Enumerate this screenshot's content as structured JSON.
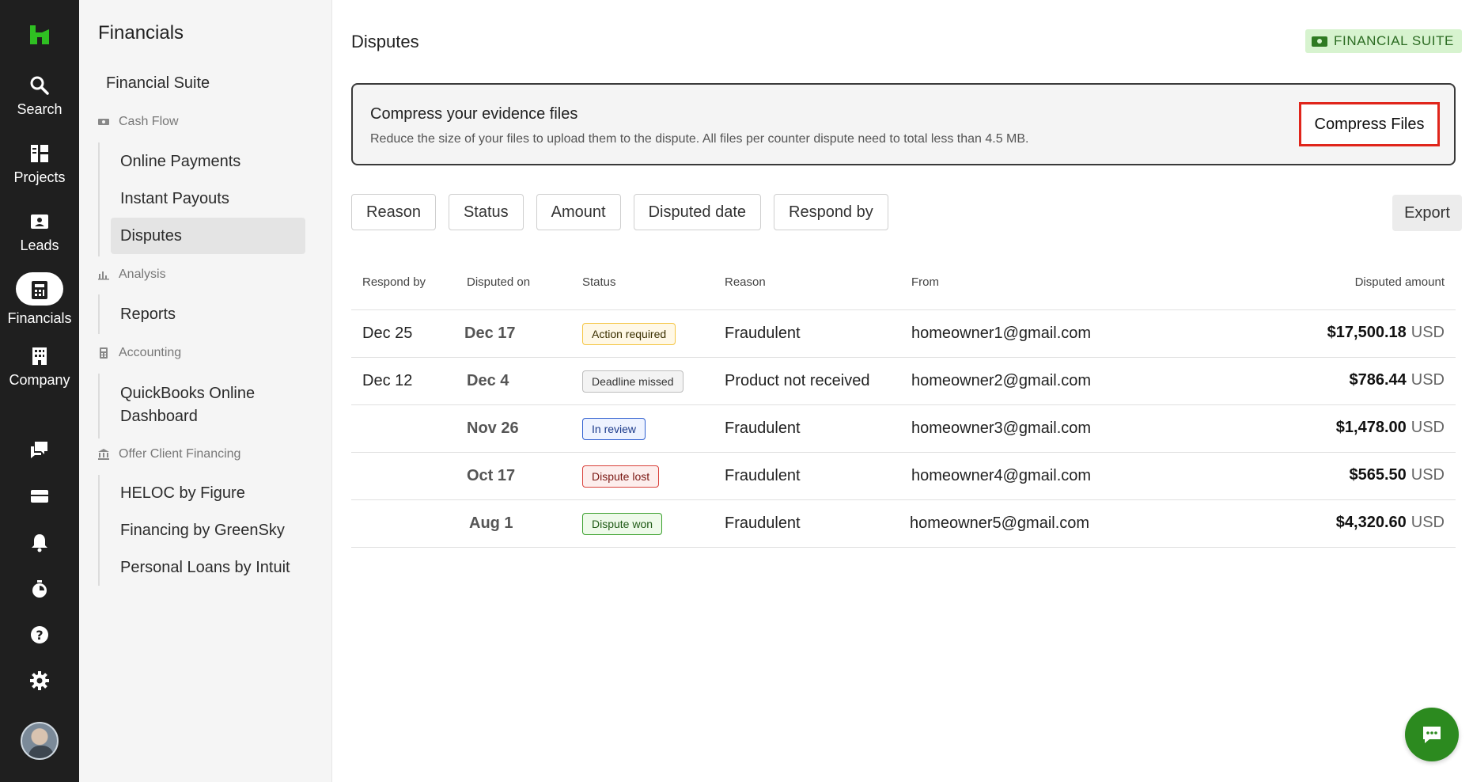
{
  "rail": {
    "items": [
      {
        "label": "Search",
        "icon": "search-icon"
      },
      {
        "label": "Projects",
        "icon": "projects-icon"
      },
      {
        "label": "Leads",
        "icon": "leads-icon"
      },
      {
        "label": "Financials",
        "icon": "financials-icon"
      },
      {
        "label": "Company",
        "icon": "company-icon"
      }
    ],
    "bottom_icons": [
      "messages-icon",
      "inbox-icon",
      "bell-icon",
      "timer-icon",
      "help-icon",
      "gear-icon"
    ]
  },
  "sidebar": {
    "title": "Financials",
    "financial_suite": "Financial Suite",
    "sections": [
      {
        "label": "Cash Flow",
        "icon": "cash-icon",
        "items": [
          "Online Payments",
          "Instant Payouts",
          "Disputes"
        ]
      },
      {
        "label": "Analysis",
        "icon": "chart-icon",
        "items": [
          "Reports"
        ]
      },
      {
        "label": "Accounting",
        "icon": "calculator-icon",
        "items": [
          "QuickBooks Online",
          "Dashboard"
        ]
      },
      {
        "label": "Offer Client Financing",
        "icon": "bank-icon",
        "items": [
          "HELOC by Figure",
          "Financing by GreenSky",
          "Personal Loans by Intuit"
        ]
      }
    ],
    "active_item": "Disputes"
  },
  "main": {
    "title": "Disputes",
    "badge": "FINANCIAL SUITE",
    "banner": {
      "title": "Compress your evidence files",
      "text": "Reduce the size of your files to upload them to the dispute. All files per counter dispute need to total less than 4.5 MB.",
      "button": "Compress Files"
    },
    "filters": [
      "Reason",
      "Status",
      "Amount",
      "Disputed date",
      "Respond by"
    ],
    "export": "Export",
    "table": {
      "headers": [
        "Respond by",
        "Disputed on",
        "Status",
        "Reason",
        "From",
        "Disputed amount"
      ],
      "rows": [
        {
          "respond_by": "Dec 25",
          "disputed_on": "Dec 17",
          "status": "Action required",
          "reason": "Fraudulent",
          "from": "homeowner1@gmail.com",
          "amount": "$17,500.18",
          "currency": "USD"
        },
        {
          "respond_by": "Dec 12",
          "disputed_on": "Dec 4",
          "status": "Deadline missed",
          "reason": "Product not received",
          "from": "homeowner2@gmail.com",
          "amount": "$786.44",
          "currency": "USD"
        },
        {
          "respond_by": "",
          "disputed_on": "Nov 26",
          "status": "In review",
          "reason": "Fraudulent",
          "from": "homeowner3@gmail.com",
          "amount": "$1,478.00",
          "currency": "USD"
        },
        {
          "respond_by": "",
          "disputed_on": "Oct 17",
          "status": "Dispute lost",
          "reason": "Fraudulent",
          "from": "homeowner4@gmail.com",
          "amount": "$565.50",
          "currency": "USD"
        },
        {
          "respond_by": "",
          "disputed_on": "Aug 1",
          "status": "Dispute won",
          "reason": "Fraudulent",
          "from": "homeowner5@gmail.com",
          "amount": "$4,320.60",
          "currency": "USD"
        }
      ]
    }
  },
  "colors": {
    "rail_bg": "#1f1f1f",
    "brand_green": "#2c8a1f",
    "highlight_red": "#e0251b",
    "status_action_required": "#f5c542",
    "status_deadline_missed": "#bdbdbd",
    "status_in_review": "#2f5fd0",
    "status_dispute_lost": "#d9413b",
    "status_dispute_won": "#3aa02d"
  }
}
